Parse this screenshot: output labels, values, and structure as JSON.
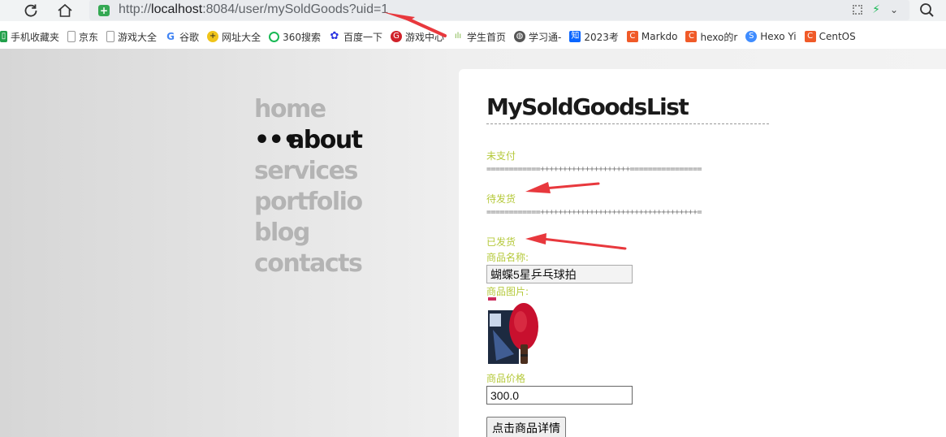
{
  "browser": {
    "url_prefix": "http://",
    "url_host": "localhost",
    "url_rest": ":8084/user/mySoldGoods?uid=1"
  },
  "bookmarks": [
    {
      "label": "手机收藏夹",
      "icon": "phone-icon",
      "color": "#21a04a"
    },
    {
      "label": "京东",
      "icon": "page-icon",
      "color": "#999999"
    },
    {
      "label": "游戏大全",
      "icon": "page-icon",
      "color": "#999999"
    },
    {
      "label": "谷歌",
      "icon": "google-icon",
      "color": "#4285f4"
    },
    {
      "label": "网址大全",
      "icon": "plus-icon",
      "color": "#f0c419"
    },
    {
      "label": "360搜索",
      "icon": "search-360-icon",
      "color": "#19b955"
    },
    {
      "label": "百度一下",
      "icon": "baidu-icon",
      "color": "#2932e1"
    },
    {
      "label": "游戏中心",
      "icon": "game-icon",
      "color": "#d0222a"
    },
    {
      "label": "学生首页",
      "icon": "bars-icon",
      "color": "#7cb342"
    },
    {
      "label": "学习通-",
      "icon": "globe-icon",
      "color": "#555555"
    },
    {
      "label": "2023考",
      "icon": "zhihu-icon",
      "color": "#0a66ff"
    },
    {
      "label": "Markdo",
      "icon": "csdn-icon",
      "color": "#f05a28"
    },
    {
      "label": "hexo的r",
      "icon": "csdn-icon",
      "color": "#f05a28"
    },
    {
      "label": "Hexo Yi",
      "icon": "s-icon",
      "color": "#3f8cff"
    },
    {
      "label": "CentOS",
      "icon": "csdn-icon",
      "color": "#f05a28"
    }
  ],
  "menu": {
    "items": [
      "home",
      "about",
      "services",
      "portfolio",
      "blog",
      "contacts"
    ],
    "active": "about",
    "active_dots": "•••"
  },
  "content": {
    "title": "MySoldGoodsList",
    "sections": {
      "unpaid": "未支付",
      "to_ship": "待发货",
      "shipped": "已发货"
    },
    "separator1": "============++++++++++++++++++++================",
    "separator2": "============+++++++++++++++++++++++++++++++++++=",
    "product": {
      "name_label": "商品名称:",
      "name_value": "蝴蝶5星乒乓球拍",
      "image_label": "商品图片:",
      "price_label": "商品价格",
      "price_value": "300.0",
      "detail_button": "点击商品详情"
    }
  },
  "colors": {
    "accent_label": "#b5c93a",
    "arrow": "#e8383d"
  }
}
